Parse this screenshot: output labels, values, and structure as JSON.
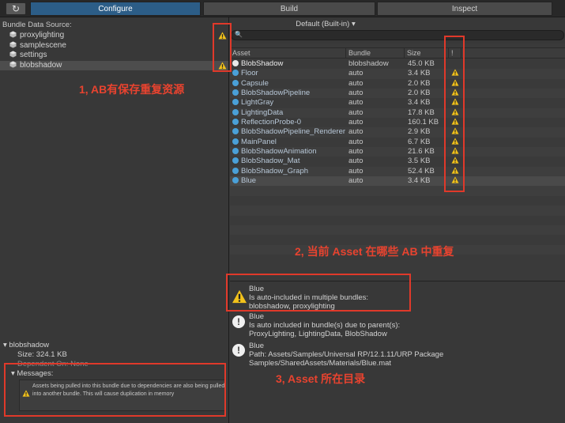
{
  "toolbar": {
    "refresh_glyph": "↻",
    "tabs": [
      {
        "label": "Configure"
      },
      {
        "label": "Build"
      },
      {
        "label": "Inspect"
      }
    ]
  },
  "left": {
    "header": "Bundle Data Source:",
    "bundles": [
      {
        "name": "proxylighting",
        "warning": true
      },
      {
        "name": "samplescene",
        "warning": false
      },
      {
        "name": "settings",
        "warning": false
      },
      {
        "name": "blobshadow",
        "warning": true
      }
    ],
    "detail": {
      "title": "blobshadow",
      "size": "Size: 324.1 KB",
      "dependent_on": "Dependent On:   None",
      "messages_label": "Messages:",
      "message": "Assets being pulled into this bundle due to dependencies are also being pulled into another bundle.  This will cause duplication in memory"
    }
  },
  "right": {
    "source_dropdown": "Default (Built-in)",
    "columns": {
      "asset": "Asset",
      "bundle": "Bundle",
      "size": "Size",
      "warn": "!"
    },
    "rows": [
      {
        "asset": "BlobShadow",
        "bundle": "blobshadow",
        "size": "45.0 KB",
        "warning": false
      },
      {
        "asset": "Floor",
        "bundle": "auto",
        "size": "3.4 KB",
        "warning": true
      },
      {
        "asset": "Capsule",
        "bundle": "auto",
        "size": "2.0 KB",
        "warning": true
      },
      {
        "asset": "BlobShadowPipeline",
        "bundle": "auto",
        "size": "2.0 KB",
        "warning": true
      },
      {
        "asset": "LightGray",
        "bundle": "auto",
        "size": "3.4 KB",
        "warning": true
      },
      {
        "asset": "LightingData",
        "bundle": "auto",
        "size": "17.8 KB",
        "warning": true
      },
      {
        "asset": "ReflectionProbe-0",
        "bundle": "auto",
        "size": "160.1 KB",
        "warning": true
      },
      {
        "asset": "BlobShadowPipeline_Renderer",
        "bundle": "auto",
        "size": "2.9 KB",
        "warning": true
      },
      {
        "asset": "MainPanel",
        "bundle": "auto",
        "size": "6.7 KB",
        "warning": true
      },
      {
        "asset": "BlobShadowAnimation",
        "bundle": "auto",
        "size": "21.6 KB",
        "warning": true
      },
      {
        "asset": "BlobShadow_Mat",
        "bundle": "auto",
        "size": "3.5 KB",
        "warning": true
      },
      {
        "asset": "BlobShadow_Graph",
        "bundle": "auto",
        "size": "52.4 KB",
        "warning": true
      },
      {
        "asset": "Blue",
        "bundle": "auto",
        "size": "3.4 KB",
        "warning": true
      }
    ],
    "messages": [
      {
        "lines": [
          "Blue",
          "Is auto-included in multiple bundles:",
          "blobshadow, proxylighting"
        ]
      },
      {
        "lines": [
          "Blue",
          "Is auto included in bundle(s) due to parent(s):",
          "ProxyLighting, LightingData, BlobShadow"
        ]
      },
      {
        "lines": [
          "Blue",
          "Path: Assets/Samples/Universal RP/12.1.11/URP Package",
          "Samples/SharedAssets/Materials/Blue.mat"
        ]
      }
    ]
  },
  "annotations": [
    {
      "text": "1, AB有保存重复资源"
    },
    {
      "text": "2, 当前 Asset 在哪些 AB 中重复"
    },
    {
      "text": "3, Asset 所在目录"
    }
  ],
  "colors": {
    "accent": "#2c5d87",
    "annotation": "#e0392a",
    "warning": "#f2c21b"
  }
}
